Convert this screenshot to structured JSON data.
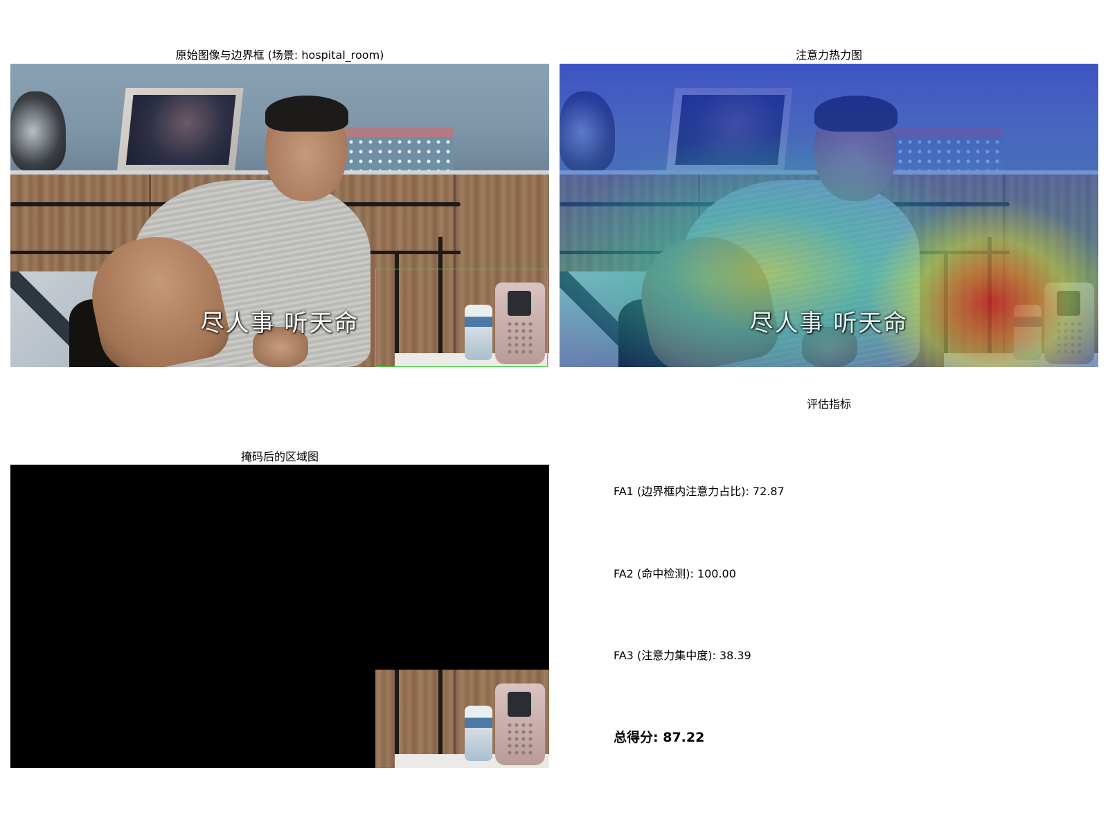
{
  "panels": {
    "original": {
      "title": "原始图像与边界框 (场景: hospital_room)",
      "subtitle": "尽人事 听天命"
    },
    "heatmap": {
      "title": "注意力热力图",
      "subtitle": "尽人事 听天命"
    },
    "masked": {
      "title": "掩码后的区域图"
    },
    "metrics": {
      "title": "评估指标",
      "fa1": {
        "label": "FA1 (边界框内注意力占比)",
        "value": "72.87"
      },
      "fa2": {
        "label": "FA2 (命中检测)",
        "value": "100.00"
      },
      "fa3": {
        "label": "FA3 (注意力集中度)",
        "value": "38.39"
      },
      "total": {
        "label": "总得分",
        "value": "87.22"
      }
    }
  },
  "colors": {
    "bbox": "#3ad13a",
    "heat_hot": "#dc1e14",
    "heat_cold": "#1e32c8"
  }
}
